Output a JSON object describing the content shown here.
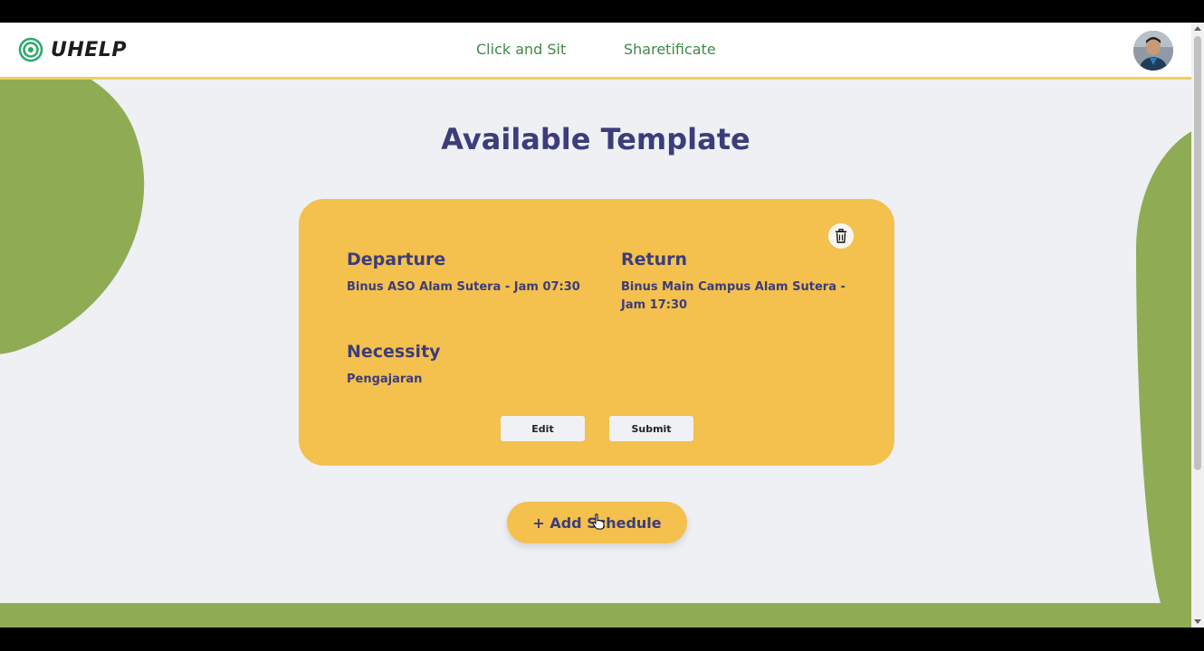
{
  "header": {
    "logo_text": "UHELP",
    "nav": [
      {
        "label": "Click and Sit"
      },
      {
        "label": "Sharetificate"
      }
    ]
  },
  "main": {
    "title": "Available Template",
    "template_card": {
      "departure": {
        "label": "Departure",
        "value": "Binus ASO Alam Sutera - Jam 07:30"
      },
      "return": {
        "label": "Return",
        "value": "Binus Main Campus Alam Sutera - Jam 17:30"
      },
      "necessity": {
        "label": "Necessity",
        "value": "Pengajaran"
      },
      "edit_label": "Edit",
      "submit_label": "Submit"
    },
    "add_schedule_label": "+ Add Schedule"
  },
  "colors": {
    "accent_yellow": "#f4c04e",
    "brand_green": "#8fac55",
    "nav_green": "#3f8a48",
    "heading_navy": "#3c3d7a"
  }
}
